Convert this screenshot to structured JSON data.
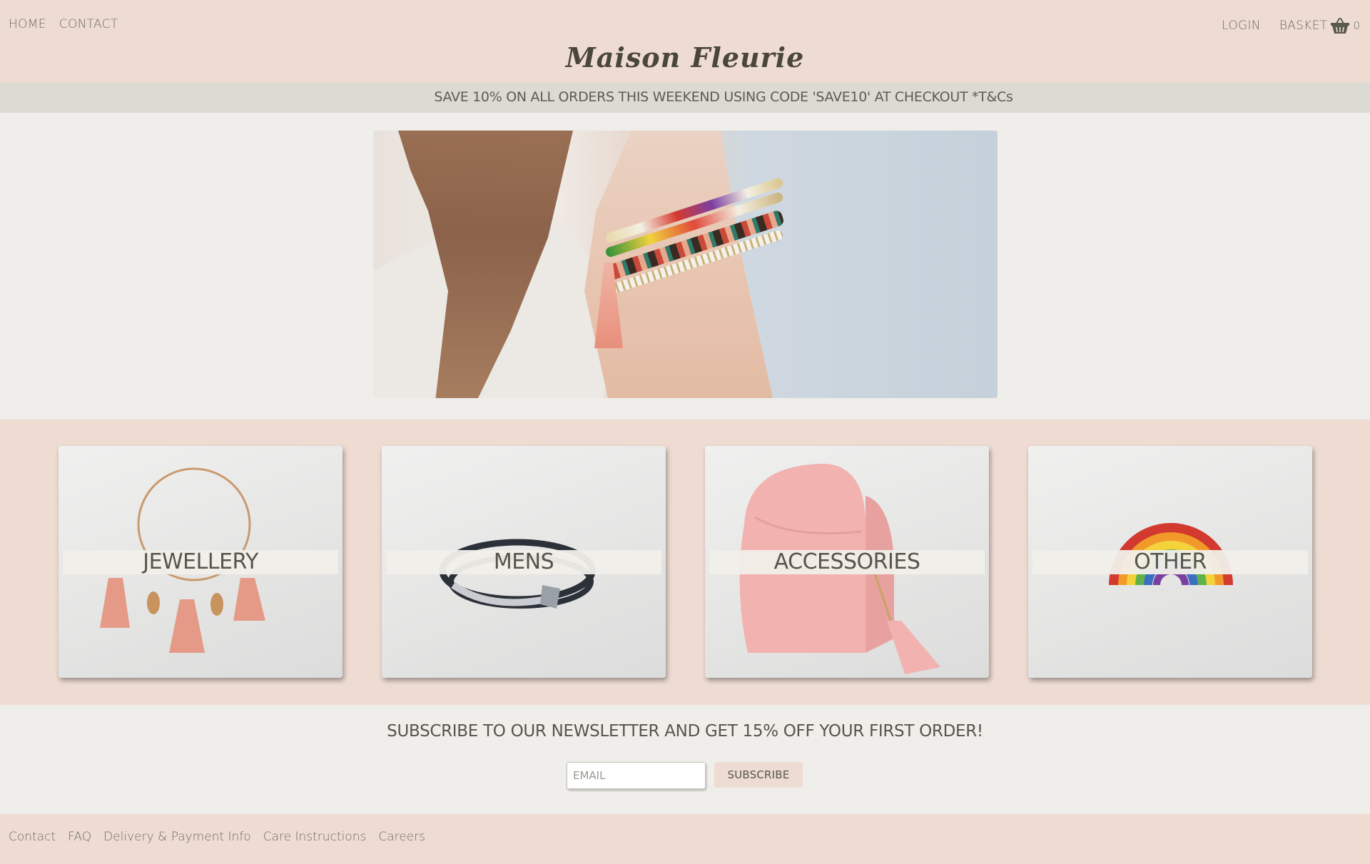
{
  "header": {
    "nav_left": [
      "HOME",
      "CONTACT"
    ],
    "login_label": "LOGIN",
    "basket_label": "BASKET",
    "basket_count": "0",
    "brand": "Maison Fleurie"
  },
  "promo": {
    "text": "SAVE 10% ON ALL ORDERS THIS WEEKEND USING CODE 'SAVE10' AT CHECKOUT *T&Cs"
  },
  "categories": [
    {
      "label": "JEWELLERY"
    },
    {
      "label": "MENS"
    },
    {
      "label": "ACCESSORIES"
    },
    {
      "label": "OTHER"
    }
  ],
  "newsletter": {
    "heading": "SUBSCRIBE TO OUR NEWSLETTER AND GET 15% OFF YOUR FIRST ORDER!",
    "email_placeholder": "EMAIL",
    "subscribe_label": "SUBSCRIBE"
  },
  "footer": {
    "links": [
      "Contact",
      "FAQ",
      "Delivery & Payment Info",
      "Care Instructions",
      "Careers"
    ]
  },
  "colors": {
    "header_bg": "#eedcd3",
    "promo_bg": "#dcdbd3",
    "page_bg": "#efeeea",
    "text": "#55554a"
  },
  "icons": {
    "basket": "basket-icon"
  }
}
